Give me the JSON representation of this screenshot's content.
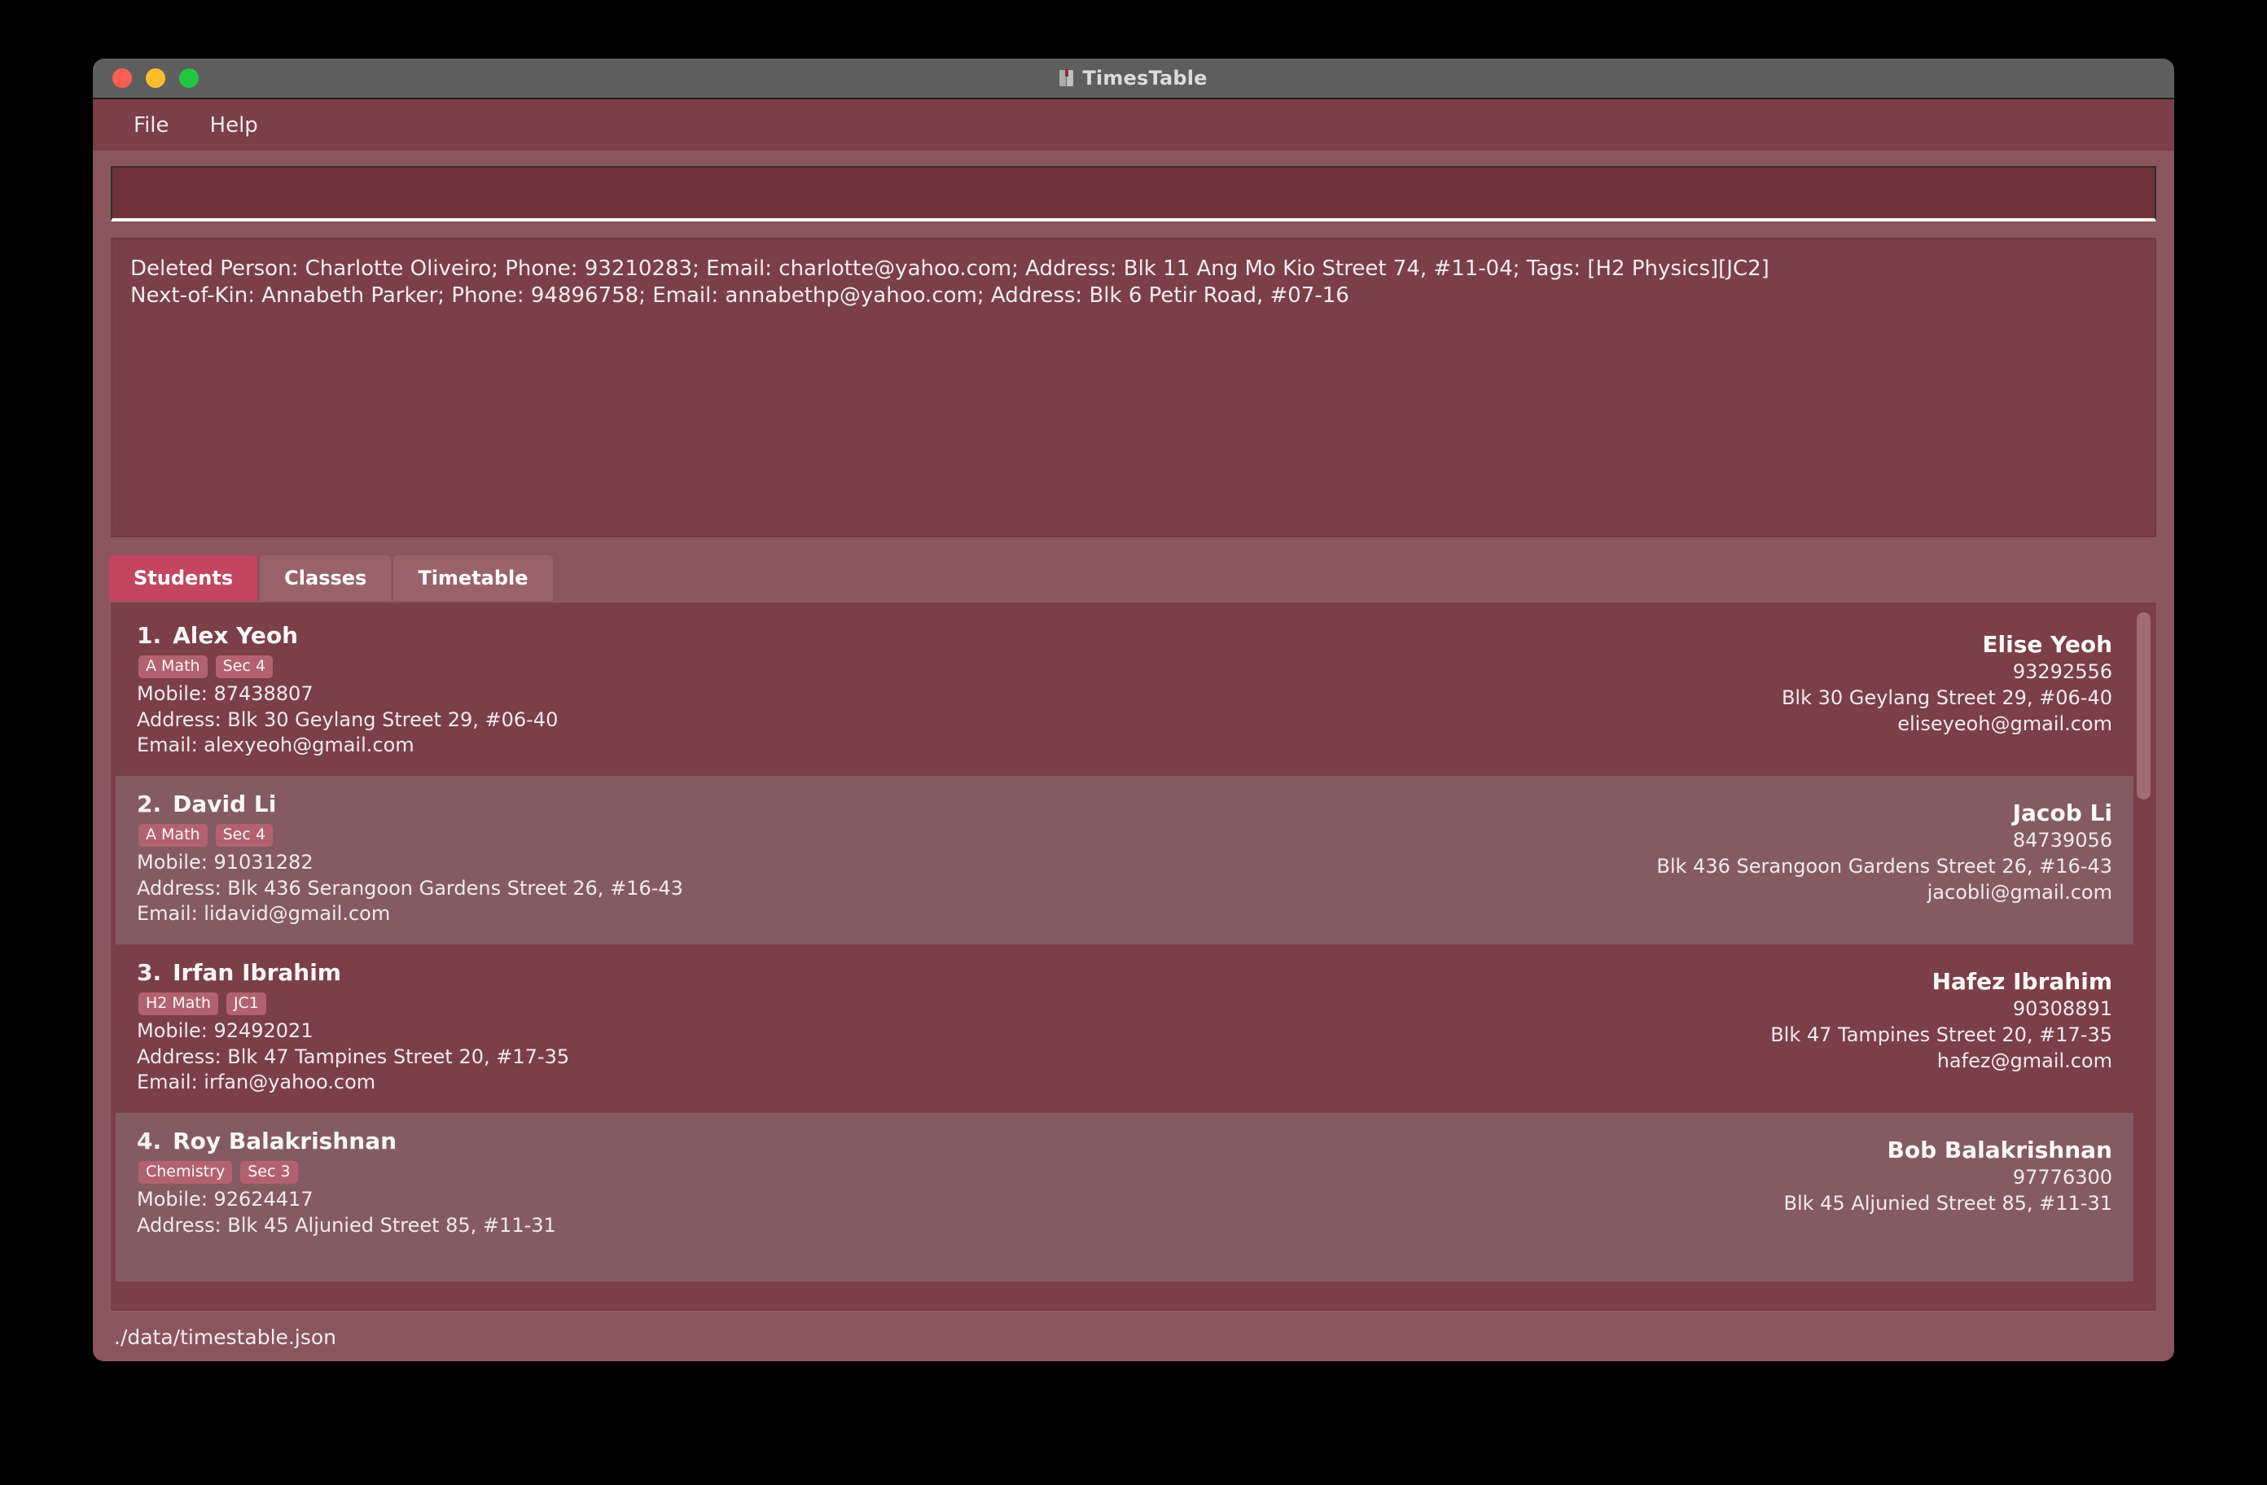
{
  "window": {
    "title": "TimesTable",
    "app_icon": "book-icon",
    "traffic_lights": [
      {
        "name": "close-button",
        "color": "#ff5f52"
      },
      {
        "name": "minimize-button",
        "color": "#fdbc2e"
      },
      {
        "name": "maximize-button",
        "color": "#22c63f"
      }
    ]
  },
  "menubar": {
    "items": [
      {
        "label": "File"
      },
      {
        "label": "Help"
      }
    ]
  },
  "command": {
    "value": "",
    "placeholder": ""
  },
  "result": {
    "lines": [
      "Deleted Person: Charlotte Oliveiro; Phone: 93210283; Email: charlotte@yahoo.com; Address: Blk 11 Ang Mo Kio Street 74, #11-04; Tags: [H2 Physics][JC2]",
      "Next-of-Kin: Annabeth Parker; Phone: 94896758; Email: annabethp@yahoo.com; Address: Blk 6 Petir Road, #07-16"
    ]
  },
  "tabs": [
    {
      "label": "Students",
      "active": true
    },
    {
      "label": "Classes",
      "active": false
    },
    {
      "label": "Timetable",
      "active": false
    }
  ],
  "students": [
    {
      "index": "1.",
      "name": "Alex Yeoh",
      "tags": [
        "A Math",
        "Sec 4"
      ],
      "mobile": "Mobile: 87438807",
      "address": "Address: Blk 30 Geylang Street 29, #06-40",
      "email": "Email: alexyeoh@gmail.com",
      "kin_name": "Elise Yeoh",
      "kin_phone": "93292556",
      "kin_address": "Blk 30 Geylang Street 29, #06-40",
      "kin_email": "eliseyeoh@gmail.com"
    },
    {
      "index": "2.",
      "name": "David Li",
      "tags": [
        "A Math",
        "Sec 4"
      ],
      "mobile": "Mobile: 91031282",
      "address": "Address: Blk 436 Serangoon Gardens Street 26, #16-43",
      "email": "Email: lidavid@gmail.com",
      "kin_name": "Jacob Li",
      "kin_phone": "84739056",
      "kin_address": "Blk 436 Serangoon Gardens Street 26, #16-43",
      "kin_email": "jacobli@gmail.com"
    },
    {
      "index": "3.",
      "name": "Irfan Ibrahim",
      "tags": [
        "H2 Math",
        "JC1"
      ],
      "mobile": "Mobile: 92492021",
      "address": "Address: Blk 47 Tampines Street 20, #17-35",
      "email": "Email: irfan@yahoo.com",
      "kin_name": "Hafez Ibrahim",
      "kin_phone": "90308891",
      "kin_address": "Blk 47 Tampines Street 20, #17-35",
      "kin_email": "hafez@gmail.com"
    },
    {
      "index": "4.",
      "name": "Roy Balakrishnan",
      "tags": [
        "Chemistry",
        "Sec 3"
      ],
      "mobile": "Mobile: 92624417",
      "address": "Address: Blk 45 Aljunied Street 85, #11-31",
      "email": "",
      "kin_name": "Bob Balakrishnan",
      "kin_phone": "97776300",
      "kin_address": "Blk 45 Aljunied Street 85, #11-31",
      "kin_email": ""
    }
  ],
  "statusbar": {
    "path": "./data/timestable.json"
  },
  "colors": {
    "window_bg": "#7b3f47",
    "titlebar_bg": "#5e5e5e",
    "row_alt_bg": "#855b63",
    "tab_active_bg": "#c4455f",
    "tab_inactive_bg": "#9a636b",
    "tag_bg": "#b2626f",
    "statusbar_bg": "#8b555d",
    "text": "#f3ecee"
  }
}
